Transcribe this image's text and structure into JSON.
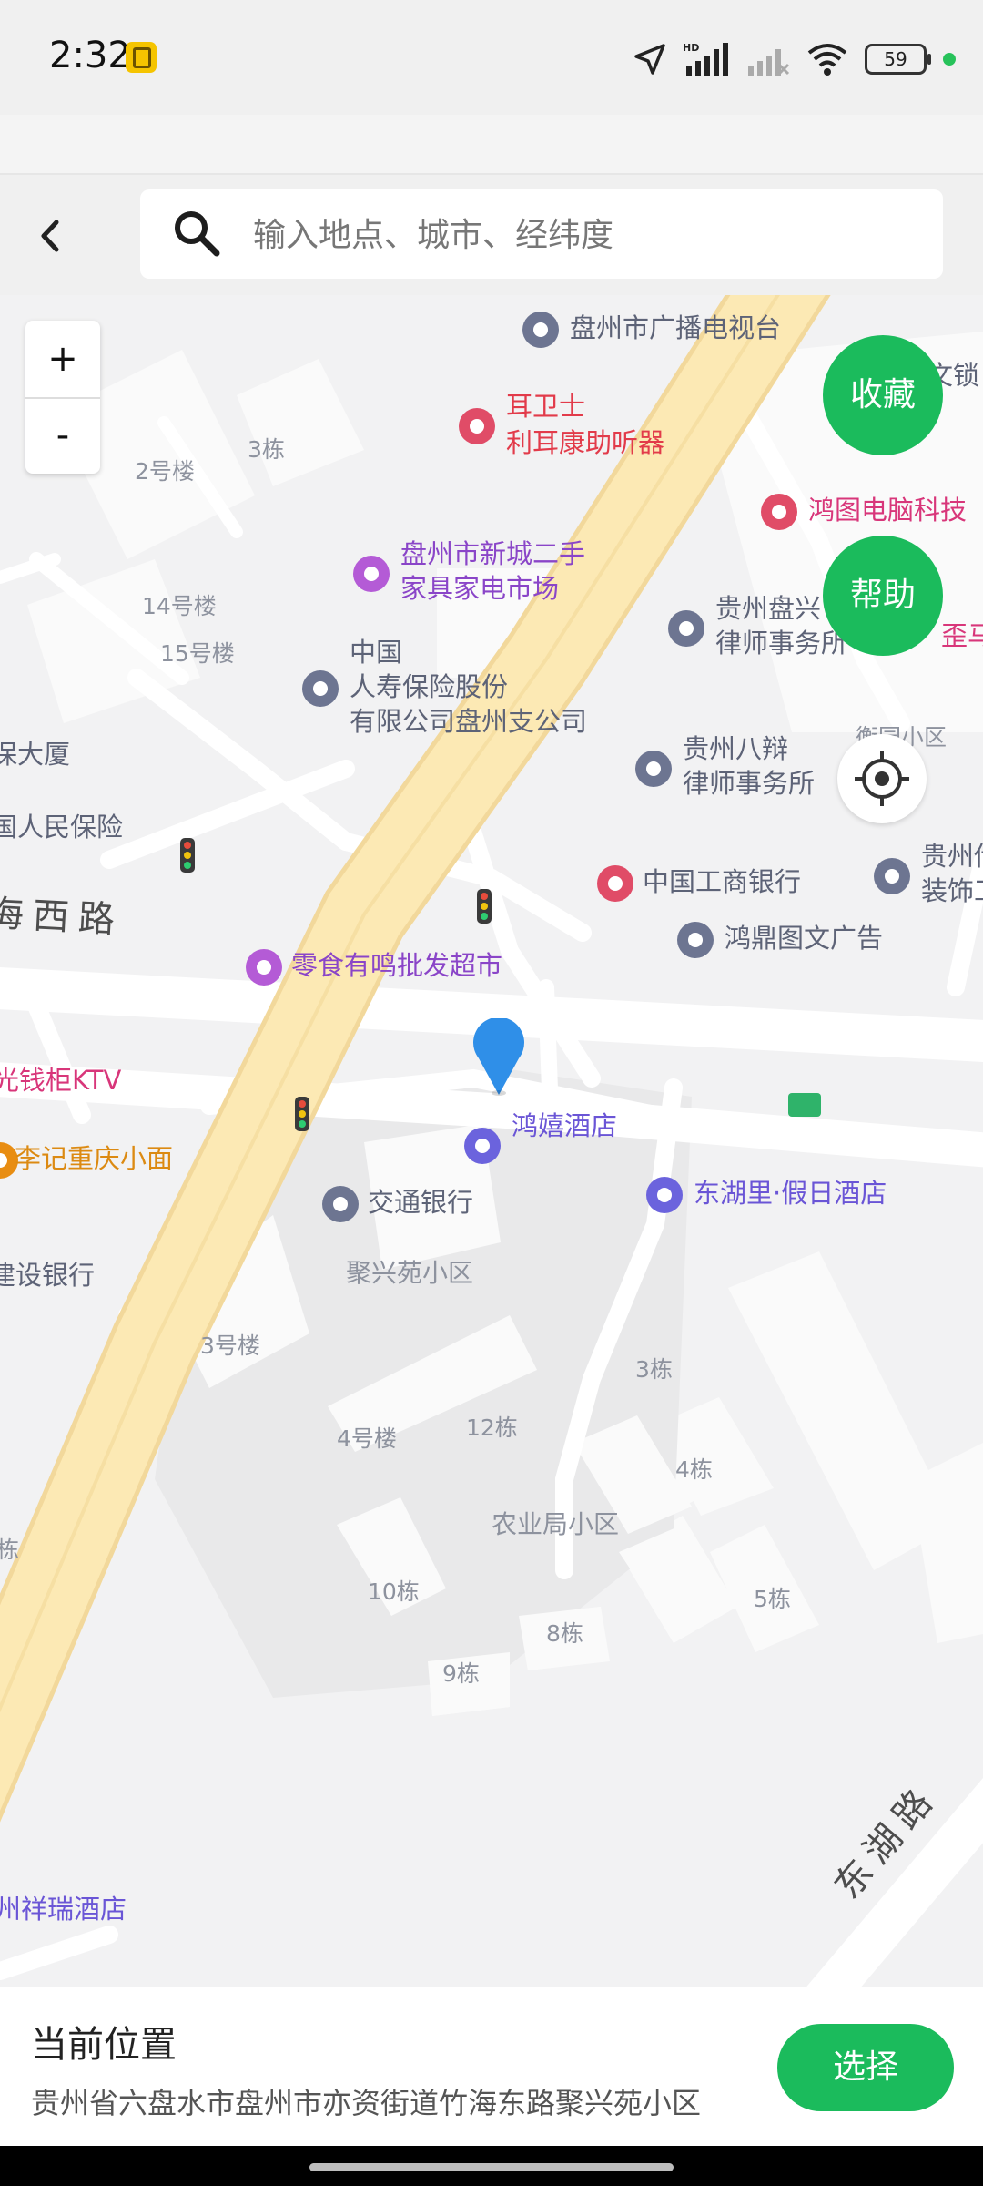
{
  "status": {
    "time": "2:32",
    "battery": "59",
    "network_badge": "HD"
  },
  "search": {
    "placeholder": "输入地点、城市、经纬度",
    "value": ""
  },
  "map_controls": {
    "zoom_in": "+",
    "zoom_out": "-",
    "favorite": "收藏",
    "help": "帮助"
  },
  "map": {
    "pois": [
      "盘州市广播电视台",
      "耳卫士",
      "利耳康助听器",
      "鸿图电脑科技",
      "文锁",
      "盘州市新城二手",
      "家具家电市场",
      "贵州盘兴",
      "律师事务所",
      "歪马",
      "中国",
      "人寿保险股份",
      "有限公司盘州支公司",
      "贵州八辩",
      "律师事务所",
      "衡园小区",
      "中国工商银行",
      "贵州传",
      "装饰工",
      "鸿鼎图文广告",
      "零食有鸣批发超市",
      "鸿嬉酒店",
      "交通银行",
      "东湖里·假日酒店",
      "光钱柜KTV",
      "李记重庆小面",
      "建设银行",
      "保大厦",
      "国人民保险",
      "州祥瑞酒店",
      "聚兴苑小区",
      "农业局小区"
    ],
    "buildings": [
      "2号楼",
      "3栋",
      "14号楼",
      "15号楼",
      "3号楼",
      "4号楼",
      "12栋",
      "3栋",
      "4栋",
      "10栋",
      "8栋",
      "9栋",
      "5栋",
      "栋"
    ],
    "roads": [
      "海西路",
      "东湖路"
    ]
  },
  "current_location": {
    "title": "当前位置",
    "address": "贵州省六盘水市盘州市亦资街道竹海东路聚兴苑小区",
    "select_label": "选择"
  },
  "colors": {
    "accent": "#1bbb5c",
    "major_road": "#fce9b4",
    "pin": "#2f8fe8"
  }
}
